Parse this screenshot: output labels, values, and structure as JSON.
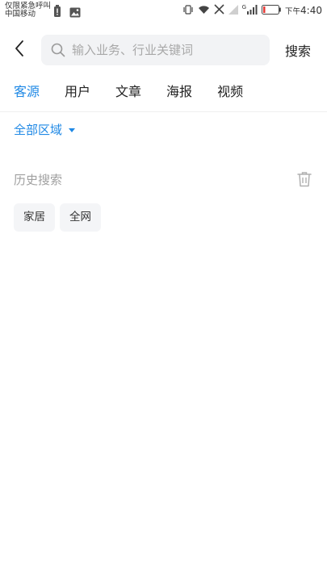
{
  "status_bar": {
    "carrier_line1": "仅限紧急呼叫",
    "carrier_line2": "中国移动",
    "time_prefix": "下午",
    "time": "4:40",
    "network_label": "G",
    "icons": [
      "battery-alert-icon",
      "image-icon",
      "vibrate-icon",
      "wifi-icon",
      "no-sim-icon",
      "signal-icon",
      "battery-low-icon"
    ]
  },
  "search": {
    "placeholder": "输入业务、行业关键词",
    "value": "",
    "button_label": "搜索"
  },
  "tabs": [
    {
      "label": "客源",
      "active": true
    },
    {
      "label": "用户",
      "active": false
    },
    {
      "label": "文章",
      "active": false
    },
    {
      "label": "海报",
      "active": false
    },
    {
      "label": "视频",
      "active": false
    }
  ],
  "area_filter": {
    "label": "全部区域"
  },
  "history": {
    "title": "历史搜索",
    "items": [
      "家居",
      "全网"
    ]
  },
  "colors": {
    "accent": "#1e88e5",
    "chip_bg": "#f4f5f7",
    "search_bg": "#f2f3f5"
  }
}
